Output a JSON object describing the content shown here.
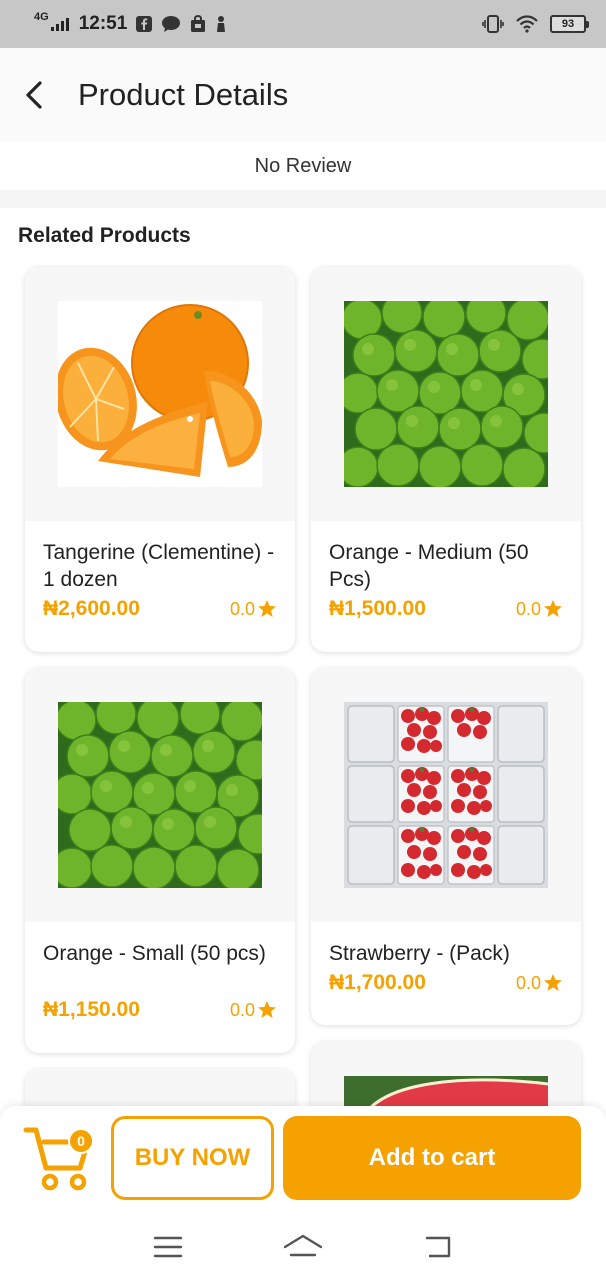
{
  "status_bar": {
    "network": "4G",
    "time": "12:51",
    "battery": "93",
    "icons": [
      "signal-icon",
      "facebook-icon",
      "messenger-icon",
      "bag-icon",
      "person-icon",
      "vibrate-icon",
      "wifi-icon",
      "battery-icon"
    ]
  },
  "header": {
    "title": "Product Details",
    "back_icon": "chevron-left-icon"
  },
  "reviews": {
    "empty_text": "No Review"
  },
  "related": {
    "title": "Related Products",
    "products": [
      {
        "name": "Tangerine (Clementine) - 1 dozen",
        "price": "₦2,600.00",
        "rating": "0.0",
        "image": "oranges-sliced"
      },
      {
        "name": "Orange - Medium (50 Pcs)",
        "price": "₦1,500.00",
        "rating": "0.0",
        "image": "green-oranges"
      },
      {
        "name": "Orange - Small (50 pcs)",
        "price": "₦1,150.00",
        "rating": "0.0",
        "image": "green-oranges"
      },
      {
        "name": "Strawberry - (Pack)",
        "price": "₦1,700.00",
        "rating": "0.0",
        "image": "strawberry-packs"
      }
    ]
  },
  "bottom_bar": {
    "cart_count": "0",
    "buy_now_label": "BUY NOW",
    "add_to_cart_label": "Add to cart"
  },
  "colors": {
    "accent": "#f5a200",
    "status_bar": "#c7c7c7"
  }
}
